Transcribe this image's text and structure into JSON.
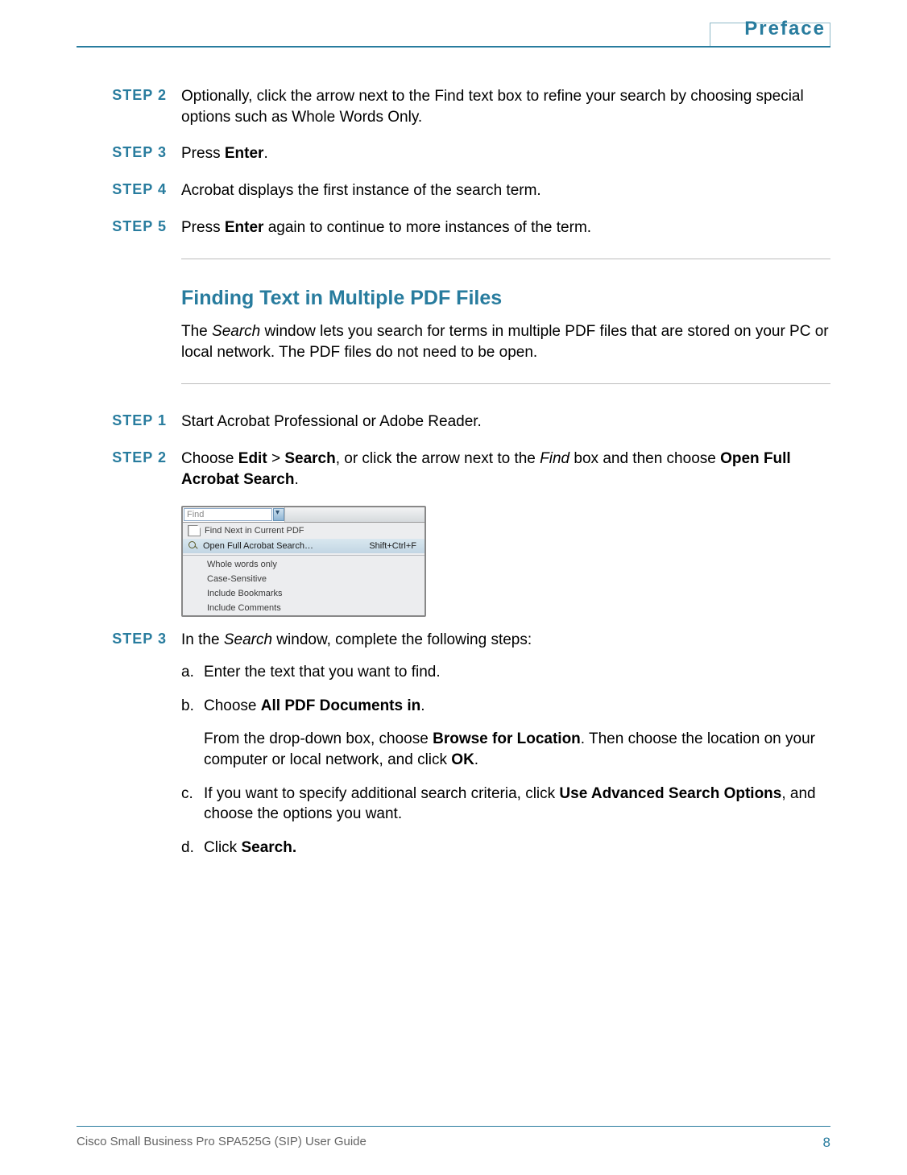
{
  "header": {
    "section": "Preface"
  },
  "steps_top": [
    {
      "label": "STEP 2",
      "parts": [
        {
          "t": "Optionally, click the arrow next to the Find text box to refine your search by choosing special options such as Whole Words Only."
        }
      ]
    },
    {
      "label": "STEP 3",
      "parts": [
        {
          "t": "Press "
        },
        {
          "t": "Enter",
          "bold": true
        },
        {
          "t": "."
        }
      ]
    },
    {
      "label": "STEP 4",
      "parts": [
        {
          "t": "Acrobat displays the first instance of the search term."
        }
      ]
    },
    {
      "label": "STEP 5",
      "parts": [
        {
          "t": "Press "
        },
        {
          "t": "Enter",
          "bold": true
        },
        {
          "t": " again to continue to more instances of the term."
        }
      ]
    }
  ],
  "section": {
    "heading": "Finding Text in Multiple PDF Files",
    "intro_parts": [
      {
        "t": "The "
      },
      {
        "t": "Search",
        "italic": true
      },
      {
        "t": " window lets you search for terms in multiple PDF files that are stored on your PC or local network. The PDF files do not need to be open."
      }
    ]
  },
  "steps_bottom": [
    {
      "label": "STEP 1",
      "parts": [
        {
          "t": "Start Acrobat Professional or Adobe Reader."
        }
      ]
    },
    {
      "label": "STEP 2",
      "parts": [
        {
          "t": "Choose "
        },
        {
          "t": "Edit",
          "bold": true
        },
        {
          "t": " > "
        },
        {
          "t": "Search",
          "bold": true
        },
        {
          "t": ", or click the arrow next to the "
        },
        {
          "t": "Find",
          "italic": true
        },
        {
          "t": " box and then choose "
        },
        {
          "t": "Open Full Acrobat Search",
          "bold": true
        },
        {
          "t": "."
        }
      ]
    }
  ],
  "dropdown": {
    "placeholder": "Find",
    "items_top": [
      {
        "label": "Find Next in Current PDF",
        "icon": "doc"
      },
      {
        "label": "Open Full Acrobat Search…",
        "shortcut": "Shift+Ctrl+F",
        "icon": "search",
        "highlight": true
      }
    ],
    "items_bottom": [
      "Whole words only",
      "Case-Sensitive",
      "Include Bookmarks",
      "Include Comments"
    ]
  },
  "step3": {
    "label": "STEP 3",
    "intro_parts": [
      {
        "t": "In the "
      },
      {
        "t": "Search",
        "italic": true
      },
      {
        "t": " window, complete the following steps:"
      }
    ],
    "subs": {
      "a_parts": [
        {
          "t": "Enter the text that you want to find."
        }
      ],
      "b_parts": [
        {
          "t": "Choose "
        },
        {
          "t": "All PDF Documents in",
          "bold": true
        },
        {
          "t": "."
        }
      ],
      "b_follow_parts": [
        {
          "t": "From the drop-down box, choose "
        },
        {
          "t": "Browse for Location",
          "bold": true
        },
        {
          "t": ". Then choose the location on your computer or local network, and click "
        },
        {
          "t": "OK",
          "bold": true
        },
        {
          "t": "."
        }
      ],
      "c_parts": [
        {
          "t": "If you want to specify additional search criteria, click "
        },
        {
          "t": "Use Advanced Search Options",
          "bold": true
        },
        {
          "t": ", and choose the options you want."
        }
      ],
      "d_parts": [
        {
          "t": "Click "
        },
        {
          "t": "Search.",
          "bold": true
        }
      ]
    },
    "letters": {
      "a": "a.",
      "b": "b.",
      "c": "c.",
      "d": "d."
    }
  },
  "footer": {
    "left": "Cisco Small Business Pro SPA525G (SIP) User Guide",
    "page": "8"
  }
}
